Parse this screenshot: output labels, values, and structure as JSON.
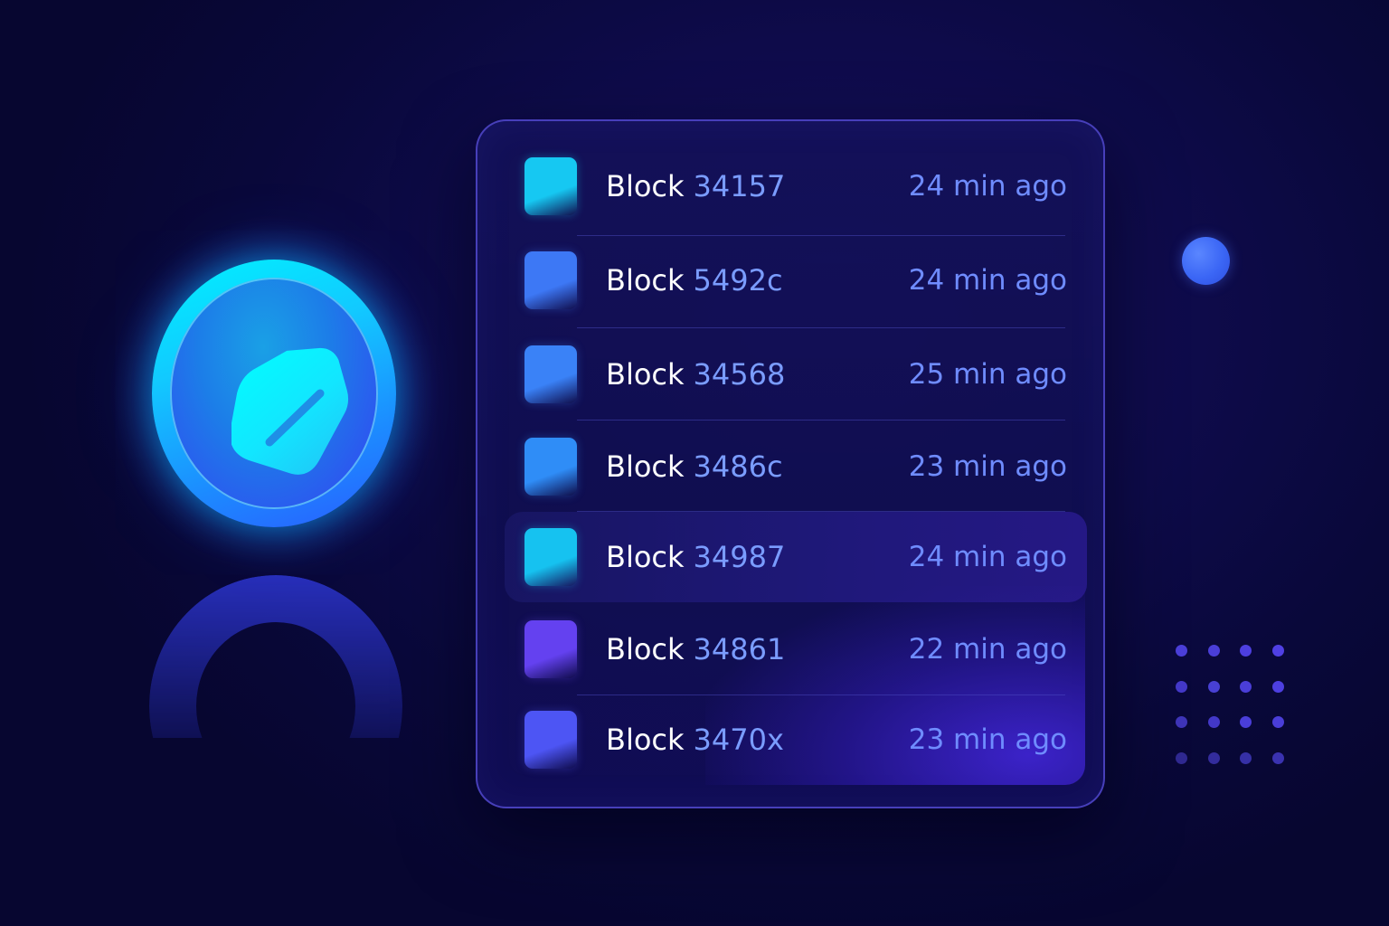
{
  "blocks": [
    {
      "word": "Block",
      "id": "34157",
      "time": "24 min ago",
      "color": "#16c8f2"
    },
    {
      "word": "Block",
      "id": "5492c",
      "time": "24 min ago",
      "color": "#3d78f5"
    },
    {
      "word": "Block",
      "id": "34568",
      "time": "25 min ago",
      "color": "#3a82f7"
    },
    {
      "word": "Block",
      "id": "3486c",
      "time": "23 min ago",
      "color": "#2f8df7"
    },
    {
      "word": "Block",
      "id": "34987",
      "time": "24 min ago",
      "color": "#16c2f0"
    },
    {
      "word": "Block",
      "id": "34861",
      "time": "22 min ago",
      "color": "#6441f0"
    },
    {
      "word": "Block",
      "id": "3470x",
      "time": "23 min ago",
      "color": "#4d55f4"
    }
  ],
  "highlighted_index": 4,
  "colors": {
    "accent_cyan": "#00f2ff",
    "accent_blue": "#3b66f5",
    "time_text": "#6f8cff",
    "id_text": "#7a9cff"
  },
  "icons": {
    "coin": "shield-badge-icon",
    "orb": "orb-icon",
    "dots": "dot-grid-icon"
  }
}
